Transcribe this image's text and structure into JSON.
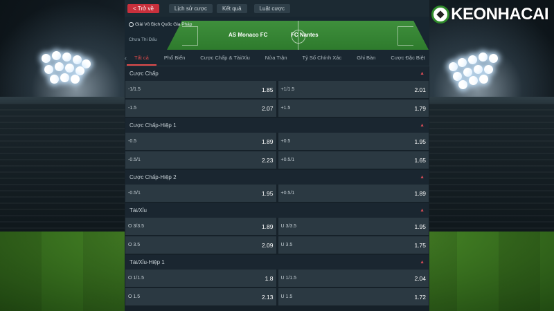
{
  "logo": {
    "text": "KEONHACAI"
  },
  "topbar": {
    "back": "< Trở về",
    "history": "Lịch sử cược",
    "results": "Kết quả",
    "rules": "Luật cược"
  },
  "match": {
    "league": "Giải Vô Địch Quốc Gia Pháp",
    "status": "Chưa Thi Đấu",
    "home": "AS Monaco FC",
    "away": "FC Nantes"
  },
  "tabs": [
    "Tất cả",
    "Phổ Biến",
    "Cược Chấp & Tài/Xỉu",
    "Nửa Trận",
    "Tỷ Số Chính Xác",
    "Ghi Bàn",
    "Cược Đặc Biệt"
  ],
  "sections": [
    {
      "title": "Cược Chấp",
      "rows": [
        [
          {
            "label": "-1/1.5",
            "odds": "1.85"
          },
          {
            "label": "+1/1.5",
            "odds": "2.01"
          }
        ],
        [
          {
            "label": "-1.5",
            "odds": "2.07"
          },
          {
            "label": "+1.5",
            "odds": "1.79"
          }
        ]
      ]
    },
    {
      "title": "Cược Chấp-Hiệp 1",
      "rows": [
        [
          {
            "label": "-0.5",
            "odds": "1.89"
          },
          {
            "label": "+0.5",
            "odds": "1.95"
          }
        ],
        [
          {
            "label": "-0.5/1",
            "odds": "2.23"
          },
          {
            "label": "+0.5/1",
            "odds": "1.65"
          }
        ]
      ]
    },
    {
      "title": "Cược Chấp-Hiệp 2",
      "rows": [
        [
          {
            "label": "-0.5/1",
            "odds": "1.95"
          },
          {
            "label": "+0.5/1",
            "odds": "1.89"
          }
        ]
      ]
    },
    {
      "title": "Tài/Xỉu",
      "rows": [
        [
          {
            "label": "O 3/3.5",
            "odds": "1.89"
          },
          {
            "label": "U 3/3.5",
            "odds": "1.95"
          }
        ],
        [
          {
            "label": "O 3.5",
            "odds": "2.09"
          },
          {
            "label": "U 3.5",
            "odds": "1.75"
          }
        ]
      ]
    },
    {
      "title": "Tài/Xỉu-Hiệp 1",
      "rows": [
        [
          {
            "label": "O 1/1.5",
            "odds": "1.8"
          },
          {
            "label": "U 1/1.5",
            "odds": "2.04"
          }
        ],
        [
          {
            "label": "O 1.5",
            "odds": "2.13"
          },
          {
            "label": "U 1.5",
            "odds": "1.72"
          }
        ]
      ]
    }
  ],
  "colors": {
    "accent": "#e34b4b",
    "back_button": "#c8303c",
    "panel_bg": "#162129",
    "odds_cell": "#2b3942"
  },
  "icons": {
    "collapse": "chevron-up-icon",
    "tab_scroll_left": "chevron-left-icon",
    "tab_scroll_right": "chevron-right-icon",
    "league": "globe-icon"
  }
}
